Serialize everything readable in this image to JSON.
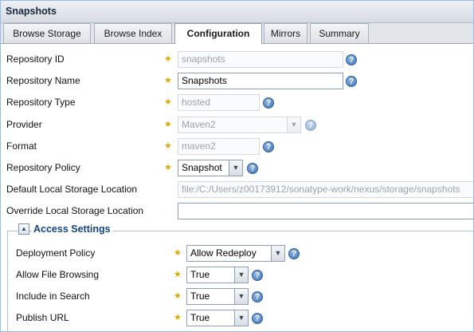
{
  "panel": {
    "title": "Snapshots"
  },
  "tabs": [
    {
      "label": "Browse Storage",
      "active": false
    },
    {
      "label": "Browse Index",
      "active": false
    },
    {
      "label": "Configuration",
      "active": true
    },
    {
      "label": "Mirrors",
      "active": false
    },
    {
      "label": "Summary",
      "active": false
    }
  ],
  "form": {
    "repository_id": {
      "label": "Repository ID",
      "value": "snapshots",
      "enabled": false
    },
    "repository_name": {
      "label": "Repository Name",
      "value": "Snapshots",
      "enabled": true
    },
    "repository_type": {
      "label": "Repository Type",
      "value": "hosted",
      "enabled": false
    },
    "provider": {
      "label": "Provider",
      "value": "Maven2",
      "enabled": false
    },
    "format": {
      "label": "Format",
      "value": "maven2",
      "enabled": false
    },
    "repository_policy": {
      "label": "Repository Policy",
      "value": "Snapshot",
      "enabled": true
    },
    "default_storage": {
      "label": "Default Local Storage Location",
      "value": "file:/C:/Users/z00173912/sonatype-work/nexus/storage/snapshots",
      "enabled": false
    },
    "override_storage": {
      "label": "Override Local Storage Location",
      "value": "",
      "enabled": true
    }
  },
  "access_settings": {
    "legend": "Access Settings",
    "deployment_policy": {
      "label": "Deployment Policy",
      "value": "Allow Redeploy"
    },
    "allow_file_browsing": {
      "label": "Allow File Browsing",
      "value": "True"
    },
    "include_in_search": {
      "label": "Include in Search",
      "value": "True"
    },
    "publish_url": {
      "label": "Publish URL",
      "value": "True"
    }
  },
  "icons": {
    "required": "star",
    "help": "question-mark-circle",
    "dropdown": "chevron-down",
    "collapse": "chevron-up"
  },
  "colors": {
    "accent": "#15428b",
    "required_star": "#e0a800",
    "help_icon": "#3e73b7"
  }
}
